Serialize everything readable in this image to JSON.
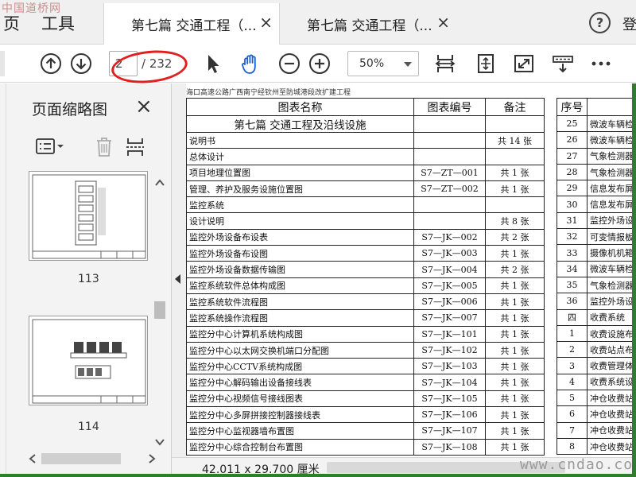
{
  "window": {
    "menu_home": "页",
    "menu_tools": "工具",
    "watermark_top": "中国道桥网",
    "login_label": "登"
  },
  "tabs": [
    {
      "label": "第七篇 交通工程（...",
      "close": "×",
      "active": true
    },
    {
      "label": "第七篇 交通工程（...",
      "close": "×",
      "active": false
    }
  ],
  "toolbar": {
    "page_current": "2",
    "page_total": "/ 232",
    "zoom": "50%",
    "icons": [
      "page-up-icon",
      "page-down-icon",
      "select-cursor-icon",
      "hand-tool-icon",
      "zoom-out-icon",
      "zoom-in-icon",
      "fit-width-icon",
      "fit-page-icon",
      "full-screen-icon",
      "scroll-mode-icon",
      "more-icon"
    ],
    "annotation_color": "#e02020"
  },
  "thumbnails": {
    "title": "页面缩略图",
    "close": "×",
    "pages": [
      "113",
      "114"
    ]
  },
  "document": {
    "header": "海口高速公路广西南宁经钦州至防城港段改扩建工程",
    "columns": [
      "图表名称",
      "图表编号",
      "备注"
    ],
    "rows": [
      {
        "name": "第七篇  交通工程及沿线设施",
        "code": "",
        "note": "",
        "section": true
      },
      {
        "name": "说明书",
        "code": "",
        "note": "共 14 张"
      },
      {
        "name": "总体设计",
        "code": "",
        "note": ""
      },
      {
        "name": "项目地理位置图",
        "code": "S7—ZT—001",
        "note": "共 1 张"
      },
      {
        "name": "管理、养护及服务设施位置图",
        "code": "S7—ZT—002",
        "note": "共 1 张"
      },
      {
        "name": "监控系统",
        "code": "",
        "note": ""
      },
      {
        "name": "设计说明",
        "code": "",
        "note": "共 8 张"
      },
      {
        "name": "监控外场设备布设表",
        "code": "S7—JK—002",
        "note": "共 2 张"
      },
      {
        "name": "监控外场设备布设图",
        "code": "S7—JK—003",
        "note": "共 1 张"
      },
      {
        "name": "监控外场设备数据传输图",
        "code": "S7—JK—004",
        "note": "共 2 张"
      },
      {
        "name": "监控系统软件总体构成图",
        "code": "S7—JK—005",
        "note": "共 1 张"
      },
      {
        "name": "监控系统软件流程图",
        "code": "S7—JK—006",
        "note": "共 1 张"
      },
      {
        "name": "监控系统操作流程图",
        "code": "S7—JK—007",
        "note": "共 1 张"
      },
      {
        "name": "监控分中心计算机系统构成图",
        "code": "S7—JK—101",
        "note": "共 1 张"
      },
      {
        "name": "监控分中心以太网交换机端口分配图",
        "code": "S7—JK—102",
        "note": "共 1 张"
      },
      {
        "name": "监控分中心CCTV系统构成图",
        "code": "S7—JK—103",
        "note": "共 1 张"
      },
      {
        "name": "监控分中心解码输出设备接线表",
        "code": "S7—JK—104",
        "note": "共 1 张"
      },
      {
        "name": "监控分中心视频信号接线图表",
        "code": "S7—JK—105",
        "note": "共 1 张"
      },
      {
        "name": "监控分中心多屏拼接控制器接线表",
        "code": "S7—JK—106",
        "note": "共 1 张"
      },
      {
        "name": "监控分中心监视器墙布置图",
        "code": "S7—JK—107",
        "note": "共 1 张"
      },
      {
        "name": "监控分中心综合控制台布置图",
        "code": "S7—JK—108",
        "note": "共 1 张"
      }
    ],
    "right_header": "序号",
    "right_rows": [
      {
        "no": "25",
        "name": "微波车辆检"
      },
      {
        "no": "26",
        "name": "微波车辆检"
      },
      {
        "no": "27",
        "name": "气象检测器"
      },
      {
        "no": "28",
        "name": "气象检测器"
      },
      {
        "no": "29",
        "name": "信息发布屏"
      },
      {
        "no": "30",
        "name": "信息发布屏"
      },
      {
        "no": "31",
        "name": "监控外场设"
      },
      {
        "no": "32",
        "name": "可变情报板"
      },
      {
        "no": "33",
        "name": "摄像机机箱"
      },
      {
        "no": "34",
        "name": "微波车辆检"
      },
      {
        "no": "35",
        "name": "气象检测器"
      },
      {
        "no": "36",
        "name": "监控外场设"
      },
      {
        "no": "四",
        "name": "收费系统"
      },
      {
        "no": "1",
        "name": "收费设施布"
      },
      {
        "no": "2",
        "name": "收费站点布"
      },
      {
        "no": "3",
        "name": "收费管理体"
      },
      {
        "no": "4",
        "name": "收费系统设"
      },
      {
        "no": "5",
        "name": "冲仓收费站"
      },
      {
        "no": "6",
        "name": "冲仓收费站"
      },
      {
        "no": "7",
        "name": "冲仓收费站"
      },
      {
        "no": "8",
        "name": "冲仓收费站"
      }
    ]
  },
  "status": {
    "page_size": "42.011 x 29.700 厘米",
    "watermark": "www.cndao.com"
  }
}
